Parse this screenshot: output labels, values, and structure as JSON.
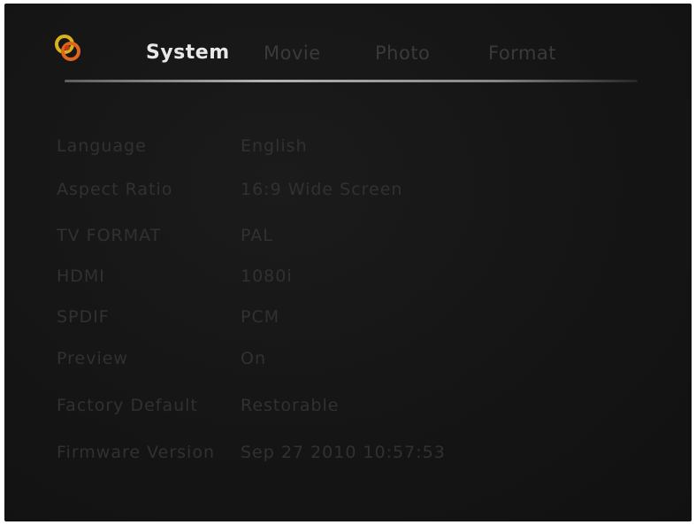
{
  "header": {
    "logo_icon": "swirl-logo-icon",
    "tabs": [
      {
        "label": "System",
        "active": true
      },
      {
        "label": "Movie",
        "active": false
      },
      {
        "label": "Photo",
        "active": false
      },
      {
        "label": "Format",
        "active": false
      }
    ]
  },
  "settings": {
    "rows": [
      {
        "label": "Language",
        "value": "English"
      },
      {
        "label": "Aspect Ratio",
        "value": "16:9 Wide Screen"
      },
      {
        "label": "TV FORMAT",
        "value": "PAL"
      },
      {
        "label": "HDMI",
        "value": "1080i"
      },
      {
        "label": "SPDIF",
        "value": "PCM"
      },
      {
        "label": "Preview",
        "value": "On"
      },
      {
        "label": "Factory Default",
        "value": "Restorable"
      },
      {
        "label": "Firmware Version",
        "value": "Sep 27 2010 10:57:53"
      }
    ]
  },
  "colors": {
    "background": "#161616",
    "active_tab": "#e8e8e8",
    "dim_text": "#313131",
    "logo_orange": "#e0651c",
    "logo_yellow": "#d8b21a"
  }
}
